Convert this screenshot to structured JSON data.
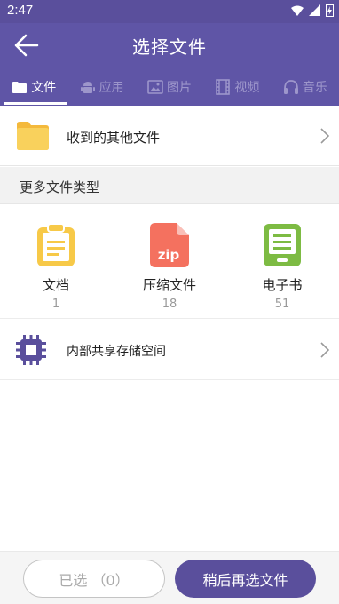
{
  "status_bar": {
    "time": "2:47",
    "icons": [
      "wifi-icon",
      "signal-icon",
      "battery-icon"
    ]
  },
  "app_bar": {
    "title": "选择文件",
    "back_icon": "arrow-left-icon"
  },
  "tabs": [
    {
      "label": "文件",
      "icon": "folder-icon",
      "active": true
    },
    {
      "label": "应用",
      "icon": "android-icon",
      "active": false
    },
    {
      "label": "图片",
      "icon": "image-icon",
      "active": false
    },
    {
      "label": "视频",
      "icon": "film-icon",
      "active": false
    },
    {
      "label": "音乐",
      "icon": "headphones-icon",
      "active": false
    }
  ],
  "received_row": {
    "label": "收到的其他文件",
    "icon": "folder-icon"
  },
  "section_header": "更多文件类型",
  "categories": [
    {
      "name": "文档",
      "count": "1",
      "icon": "clipboard-icon",
      "color": "#f7c948"
    },
    {
      "name": "压缩文件",
      "count": "18",
      "icon": "zip-file-icon",
      "color": "#f4715f",
      "icon_text": "zip"
    },
    {
      "name": "电子书",
      "count": "51",
      "icon": "ebook-icon",
      "color": "#7dbb43"
    }
  ],
  "storage_row": {
    "label": "内部共享存储空间",
    "icon": "chip-icon"
  },
  "bottom_bar": {
    "selected_label": "已选 （0）",
    "later_label": "稍后再选文件"
  },
  "colors": {
    "primary": "#5f55a6",
    "status_bar": "#5a4f9c",
    "folder": "#f9d15c",
    "chip": "#5a4f9c"
  }
}
